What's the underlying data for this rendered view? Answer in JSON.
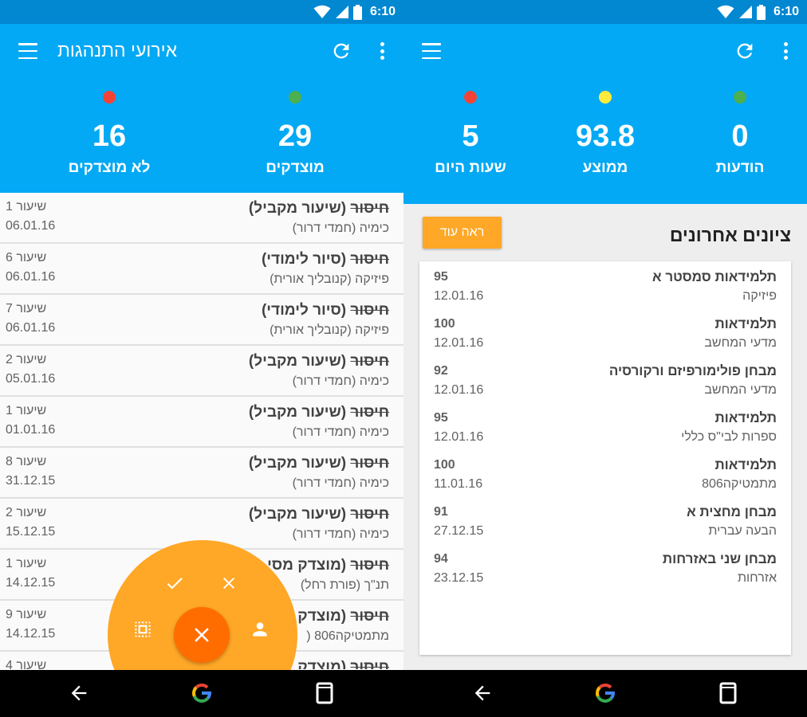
{
  "status_bar": {
    "time": "6:10"
  },
  "left": {
    "app_title": "אירועי התנהגות",
    "stats": [
      {
        "value": "29",
        "label": "מוצדקים",
        "dot_color": "#4caf50"
      },
      {
        "value": "16",
        "label": "לא מוצדקים",
        "dot_color": "#f44336"
      }
    ],
    "events": [
      {
        "strike": "חיסור",
        "title_rest": " (שיעור מקביל)",
        "subtitle": "כימיה (חמדי דרור)",
        "lesson": "שיעור 1",
        "date": "06.01.16"
      },
      {
        "strike": "חיסור",
        "title_rest": " (סיור לימודי)",
        "subtitle": "פיזיקה (קנובליך אורית)",
        "lesson": "שיעור 6",
        "date": "06.01.16"
      },
      {
        "strike": "חיסור",
        "title_rest": " (סיור לימודי)",
        "subtitle": "פיזיקה (קנובליך אורית)",
        "lesson": "שיעור 7",
        "date": "06.01.16"
      },
      {
        "strike": "חיסור",
        "title_rest": " (שיעור מקביל)",
        "subtitle": "כימיה (חמדי דרור)",
        "lesson": "שיעור 2",
        "date": "05.01.16"
      },
      {
        "strike": "חיסור",
        "title_rest": " (שיעור מקביל)",
        "subtitle": "כימיה (חמדי דרור)",
        "lesson": "שיעור 1",
        "date": "01.01.16"
      },
      {
        "strike": "חיסור",
        "title_rest": " (שיעור מקביל)",
        "subtitle": "כימיה (חמדי דרור)",
        "lesson": "שיעור 8",
        "date": "31.12.15"
      },
      {
        "strike": "חיסור",
        "title_rest": " (שיעור מקביל)",
        "subtitle": "כימיה (חמדי דרור)",
        "lesson": "שיעור 2",
        "date": "15.12.15"
      },
      {
        "strike": "חיסור",
        "title_rest": " (מוצדק מסי",
        "subtitle": "תנ\"ך (פורת רחל)",
        "lesson": "שיעור 1",
        "date": "14.12.15"
      },
      {
        "strike": "חיסור",
        "title_rest": " (מוצדק",
        "subtitle": "מתמטיקה806 (",
        "lesson": "שיעור 9",
        "date": "14.12.15"
      },
      {
        "strike": "חיסור",
        "title_rest": " (מוצדק",
        "subtitle": "",
        "lesson": "שיעור 4",
        "date": ""
      }
    ],
    "fab_colors": {
      "circle": "#ffa726",
      "main": "#ff6d00"
    }
  },
  "right": {
    "stats": [
      {
        "value": "0",
        "label": "הודעות",
        "dot_color": "#4caf50"
      },
      {
        "value": "93.8",
        "label": "ממוצע",
        "dot_color": "#ffeb3b"
      },
      {
        "value": "5",
        "label": "שעות היום",
        "dot_color": "#f44336"
      }
    ],
    "section_title": "ציונים אחרונים",
    "more_button": "ראה עוד",
    "grades": [
      {
        "title": "תלמידאות סמסטר א",
        "subject": "פיזיקה",
        "score": "95",
        "date": "12.01.16"
      },
      {
        "title": "תלמידאות",
        "subject": "מדעי המחשב",
        "score": "100",
        "date": "12.01.16"
      },
      {
        "title": "מבחן פולימורפיזם ורקורסיה",
        "subject": "מדעי המחשב",
        "score": "92",
        "date": "12.01.16"
      },
      {
        "title": "תלמידאות",
        "subject": "ספרות לבי\"ס כללי",
        "score": "95",
        "date": "12.01.16"
      },
      {
        "title": "תלמידאות",
        "subject": "מתמטיקה806",
        "score": "100",
        "date": "11.01.16"
      },
      {
        "title": "מבחן מחצית א",
        "subject": "הבעה עברית",
        "score": "91",
        "date": "27.12.15"
      },
      {
        "title": "מבחן שני באזרחות",
        "subject": "אזרחות",
        "score": "94",
        "date": "23.12.15"
      }
    ]
  },
  "colors": {
    "status_bar": "#0288d1",
    "app_bar": "#03a9f4",
    "accent": "#ffa726"
  },
  "icons": [
    "wifi-icon",
    "signal-icon",
    "battery-icon",
    "menu-icon",
    "refresh-icon",
    "more-vert-icon",
    "check-icon",
    "close-icon",
    "select-all-icon",
    "person-icon",
    "back-icon",
    "google-icon",
    "recents-icon"
  ]
}
